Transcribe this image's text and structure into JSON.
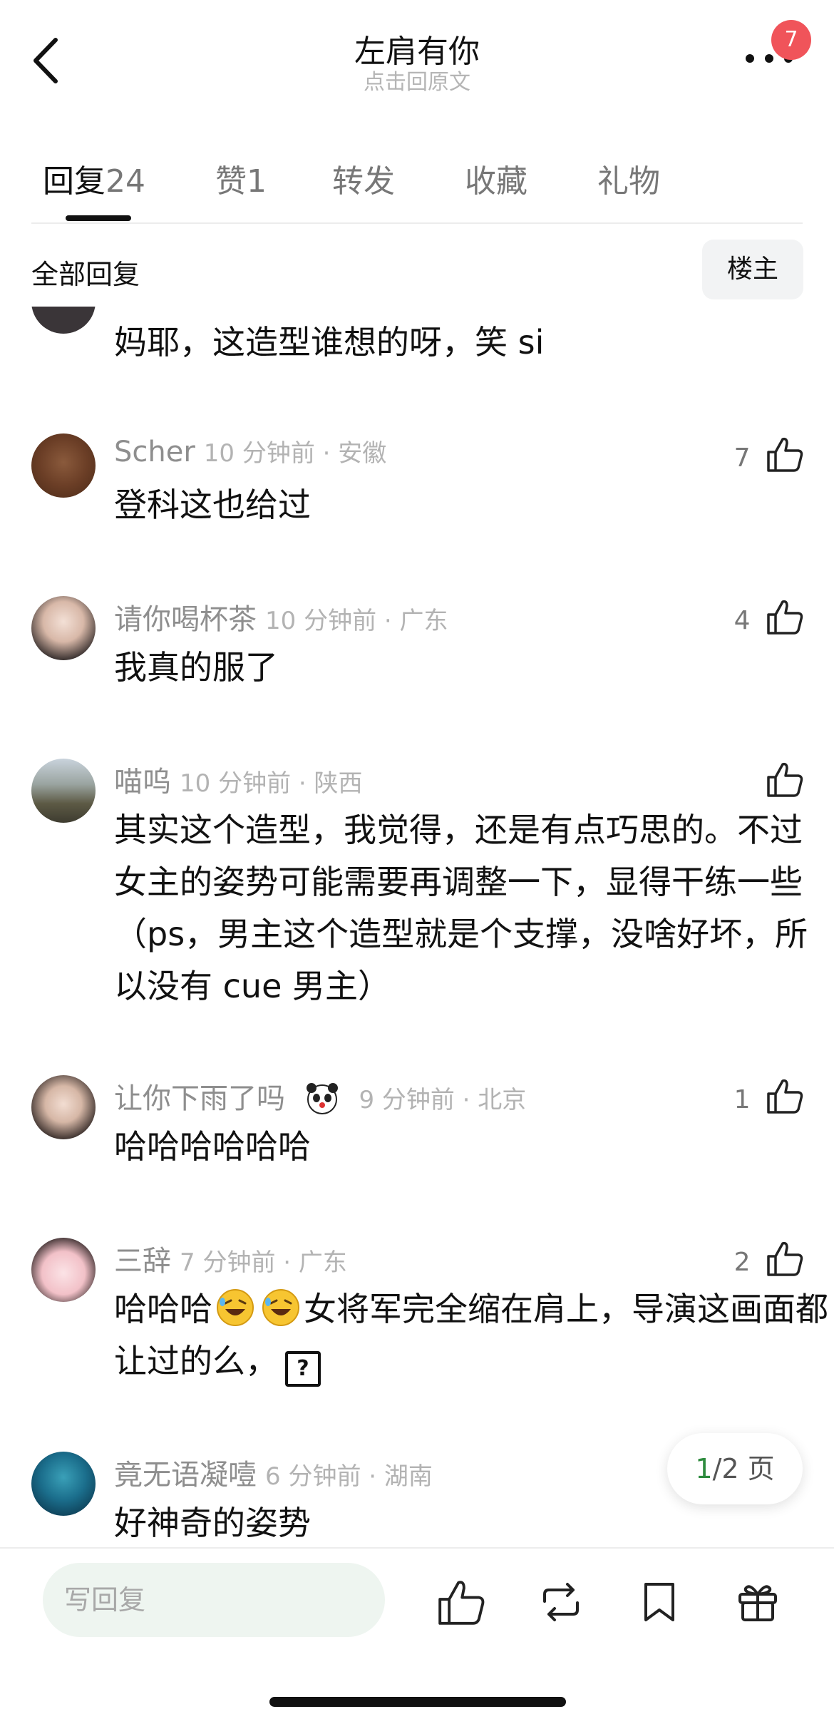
{
  "header": {
    "title": "左肩有你",
    "subtitle": "点击回原文",
    "notification_count": "7"
  },
  "tabs": [
    {
      "label": "回复",
      "count": "24"
    },
    {
      "label": "赞",
      "count": "1"
    },
    {
      "label": "转发",
      "count": ""
    },
    {
      "label": "收藏",
      "count": ""
    },
    {
      "label": "礼物",
      "count": ""
    }
  ],
  "section": {
    "title": "全部回复",
    "owner_filter": "楼主"
  },
  "partial_comment": {
    "text": "妈耶，这造型谁想的呀，笑 si"
  },
  "comments": [
    {
      "name": "Scher",
      "time": "10 分钟前 · 安徽",
      "text": "登科这也给过",
      "likes": "7"
    },
    {
      "name": "请你喝杯茶",
      "time": "10 分钟前 · 广东",
      "text": "我真的服了",
      "likes": "4"
    },
    {
      "name": "喵呜",
      "time": "10 分钟前 · 陕西",
      "text": "其实这个造型，我觉得，还是有点巧思的。不过女主的姿势可能需要再调整一下，显得干练一些（ps，男主这个造型就是个支撑，没啥好坏，所以没有 cue 男主）",
      "likes": ""
    },
    {
      "name": "让你下雨了吗",
      "time": "9 分钟前 · 北京",
      "text": "哈哈哈哈哈哈",
      "likes": "1",
      "badge_icon": "panda-emoji"
    },
    {
      "name": "三辞",
      "time": "7 分钟前 · 广东",
      "text_a": "哈哈哈",
      "text_b": "女将军完全缩在肩上，导演这画面都让过的么，",
      "likes": "2",
      "inline_icons": [
        "rofl-emoji",
        "rofl-emoji",
        "question-box-icon"
      ]
    },
    {
      "name": "竟无语凝噎",
      "time": "6 分钟前 · 湖南",
      "text": "好神奇的姿势",
      "likes": ""
    }
  ],
  "pager": {
    "current": "1",
    "total": "/2 页"
  },
  "bottom_bar": {
    "reply_placeholder": "写回复",
    "icons": [
      "like-icon",
      "repost-icon",
      "bookmark-icon",
      "gift-icon"
    ]
  },
  "colors": {
    "accent_green": "#2e8b3e",
    "badge_red": "#f0545a"
  }
}
